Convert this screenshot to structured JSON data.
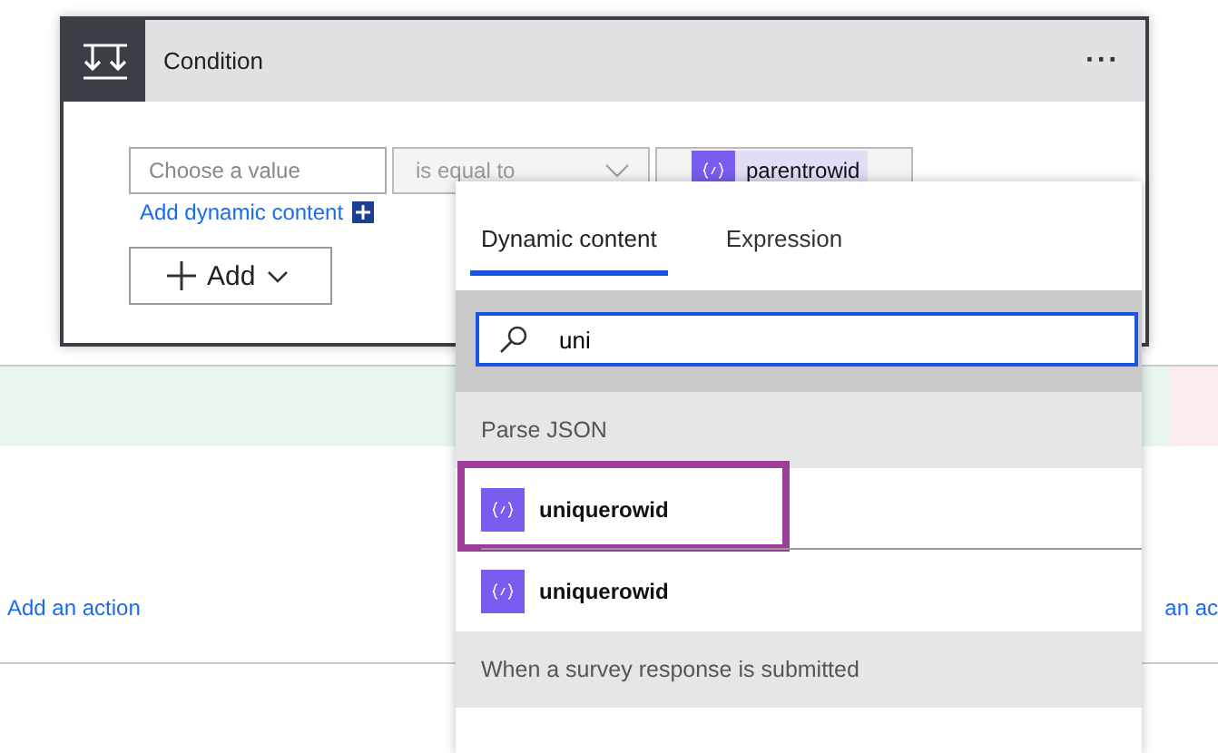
{
  "condition": {
    "title": "Condition",
    "menu": "···",
    "value_placeholder": "Choose a value",
    "operator": "is equal to",
    "token": "parentrowid",
    "add_dynamic": "Add dynamic content",
    "add_button": "Add"
  },
  "branches": {
    "left_action": "Add an action",
    "right_action": "an ac"
  },
  "dynamic_panel": {
    "tabs": [
      {
        "label": "Dynamic content",
        "selected": true
      },
      {
        "label": "Expression",
        "selected": false
      }
    ],
    "search": {
      "value": "uni"
    },
    "sections": [
      {
        "title": "Parse JSON",
        "items": [
          {
            "label": "uniquerowid",
            "kind": "json",
            "highlighted": true
          },
          {
            "label": "uniquerowid",
            "kind": "json",
            "highlighted": false
          }
        ]
      },
      {
        "title": "When a survey response is submitted"
      }
    ]
  }
}
